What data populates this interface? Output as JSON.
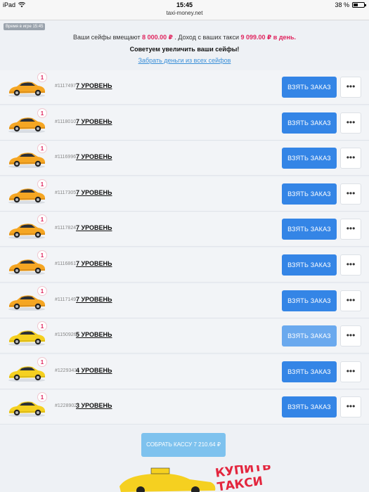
{
  "status": {
    "device": "iPad",
    "time": "15:45",
    "battery": "38 %"
  },
  "browser": {
    "url": "taxi-money.net"
  },
  "time_badge": "Время в игре 15:45",
  "info": {
    "text1": "Ваши сейфы вмещают ",
    "safe_amount": "8 000.00 ₽",
    "text2": " . Доход с ваших такси ",
    "income_amount": "9 099.00 ₽ в день.",
    "advice": "Советуем увеличить ваши сейфы!",
    "withdraw_link": "Забрать деньги из всех сейфов"
  },
  "colors": {
    "accent": "#3485e6",
    "accent_light": "#6aa9ee",
    "red": "#e0245e",
    "car_orange": "#f5a623",
    "car_yellow": "#f5d020"
  },
  "rows": [
    {
      "id": "#1117497",
      "level": "7 УРОВЕНЬ",
      "count": "1",
      "button": "ВЗЯТЬ ЗАКАЗ",
      "more": "•••",
      "car": "orange"
    },
    {
      "id": "#1118010",
      "level": "7 УРОВЕНЬ",
      "count": "1",
      "button": "ВЗЯТЬ ЗАКАЗ",
      "more": "•••",
      "car": "orange"
    },
    {
      "id": "#1116996",
      "level": "7 УРОВЕНЬ",
      "count": "1",
      "button": "ВЗЯТЬ ЗАКАЗ",
      "more": "•••",
      "car": "orange"
    },
    {
      "id": "#1117305",
      "level": "7 УРОВЕНЬ",
      "count": "1",
      "button": "ВЗЯТЬ ЗАКАЗ",
      "more": "•••",
      "car": "orange"
    },
    {
      "id": "#1117824",
      "level": "7 УРОВЕНЬ",
      "count": "1",
      "button": "ВЗЯТЬ ЗАКАЗ",
      "more": "•••",
      "car": "orange"
    },
    {
      "id": "#1116861",
      "level": "7 УРОВЕНЬ",
      "count": "1",
      "button": "ВЗЯТЬ ЗАКАЗ",
      "more": "•••",
      "car": "orange"
    },
    {
      "id": "#1117149",
      "level": "7 УРОВЕНЬ",
      "count": "1",
      "button": "ВЗЯТЬ ЗАКАЗ",
      "more": "•••",
      "car": "orange"
    },
    {
      "id": "#1150926",
      "level": "5 УРОВЕНЬ",
      "count": "1",
      "button": "ВЗЯТЬ ЗАКАЗ",
      "more": "•••",
      "car": "yellow"
    },
    {
      "id": "#1229343",
      "level": "4 УРОВЕНЬ",
      "count": "1",
      "button": "ВЗЯТЬ ЗАКАЗ",
      "more": "•••",
      "car": "yellow"
    },
    {
      "id": "#1228902",
      "level": "3 УРОВЕНЬ",
      "count": "1",
      "button": "ВЗЯТЬ ЗАКАЗ",
      "more": "•••",
      "car": "yellow"
    }
  ],
  "collect_button": "СОБРАТЬ КАССУ 7 210.64 ₽",
  "banner": {
    "text": "КУПИТЬ ТАКСИ"
  }
}
